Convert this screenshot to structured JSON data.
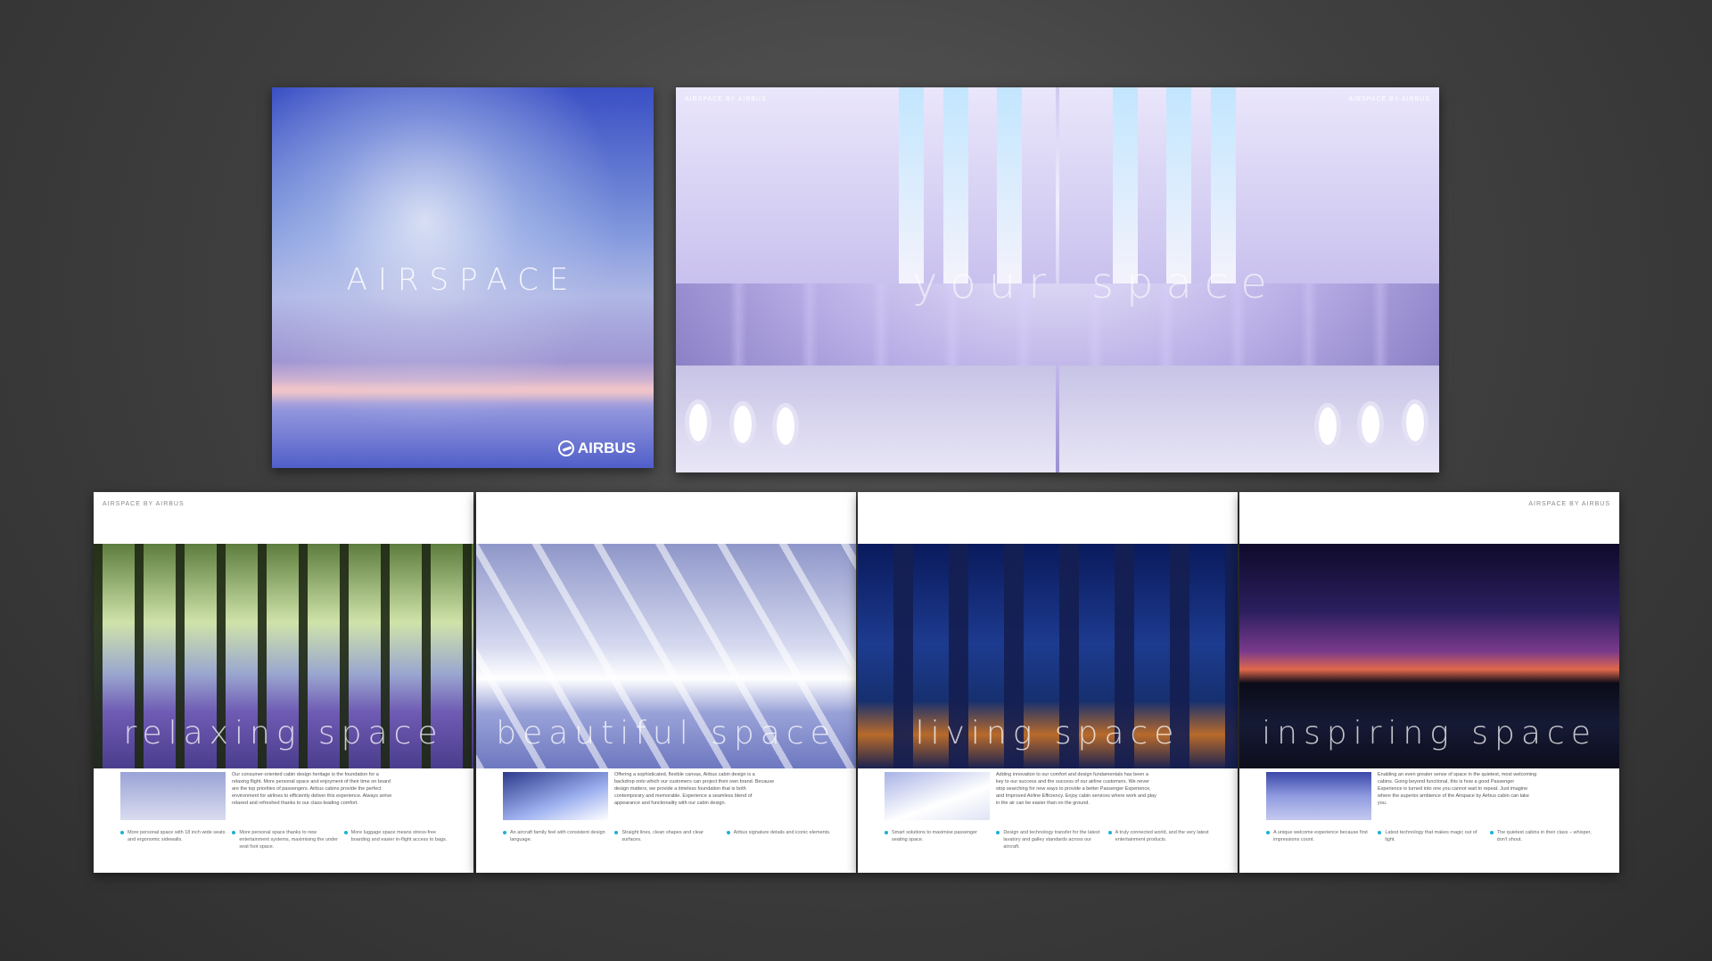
{
  "cover": {
    "title": "AIRSPACE",
    "logo_text": "AIRBUS"
  },
  "spread": {
    "header_left": "AIRSPACE BY AIRBUS",
    "header_right": "AIRSPACE BY AIRBUS",
    "title_left": "your",
    "title_right": "space"
  },
  "panels": [
    {
      "header": "AIRSPACE BY AIRBUS",
      "title": "relaxing space",
      "intro": "Our consumer-oriented cabin design heritage is the foundation for a relaxing flight. More personal space and enjoyment of their time on board are the top priorities of passengers. Airbus cabins provide the perfect environment for airlines to efficiently deliver this experience. Always arrive relaxed and refreshed thanks to our class-leading comfort.",
      "bullets": [
        "More personal space with 18 inch wide seats and ergonomic sidewalls.",
        "More personal space thanks to new entertainment systems, maximising the under seat foot space.",
        "More luggage space means stress-free boarding and easier in-flight access to bags."
      ]
    },
    {
      "header": "",
      "title": "beautiful space",
      "intro": "Offering a sophisticated, flexible canvas, Airbus cabin design is a backdrop onto which our customers can project their own brand. Because design matters, we provide a timeless foundation that is both contemporary and memorable. Experience a seamless blend of appearance and functionality with our cabin design.",
      "bullets": [
        "An aircraft family feel with consistent design language.",
        "Straight lines, clean shapes and clear surfaces.",
        "Airbus signature details and iconic elements."
      ]
    },
    {
      "header": "",
      "title": "living space",
      "intro": "Adding innovation to our comfort and design fundamentals has been a key to our success and the success of our airline customers. We never stop searching for new ways to provide a better Passenger Experience, and Improved Airline Efficiency. Enjoy cabin services where work and play in the air can be easier than on the ground.",
      "bullets": [
        "Smart solutions to maximise passenger seating space.",
        "Design and technology transfer for the latest lavatory and galley standards across our aircraft.",
        "A truly connected world, and the very latest entertainment products."
      ]
    },
    {
      "header": "AIRSPACE BY AIRBUS",
      "title": "inspiring space",
      "intro": "Enabling an even greater sense of space in the quietest, most welcoming cabins. Going beyond functional, this is how a good Passenger Experience is turned into one you cannot wait to repeat. Just imagine where the superior ambience of the Airspace by Airbus cabin can take you.",
      "bullets": [
        "A unique welcome experience because first impressions count.",
        "Latest technology that makes magic out of light.",
        "The quietest cabins in their class – whisper, don't shout."
      ]
    }
  ]
}
